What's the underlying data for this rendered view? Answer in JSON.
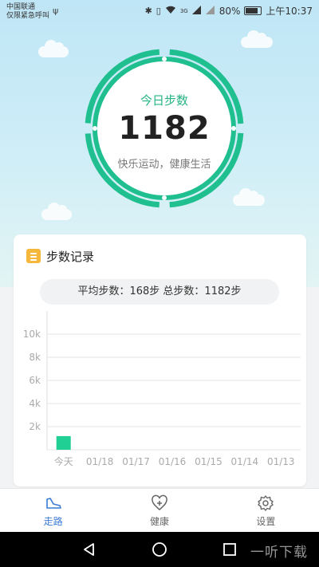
{
  "status_bar": {
    "carrier_line1": "中国联通",
    "carrier_line2": "仅限紧急呼叫",
    "battery": "80%",
    "time": "上午10:37",
    "network": "3G"
  },
  "today": {
    "label": "今日步数",
    "steps": "1182",
    "slogan": "快乐运动，健康生活"
  },
  "record": {
    "title": "步数记录",
    "summary": "平均步数：168步  总步数：1182步"
  },
  "chart_data": {
    "type": "bar",
    "categories": [
      "今天",
      "01/18",
      "01/17",
      "01/16",
      "01/15",
      "01/14",
      "01/13"
    ],
    "values": [
      1182,
      0,
      0,
      0,
      0,
      0,
      0
    ],
    "y_ticks": [
      "2k",
      "4k",
      "6k",
      "8k",
      "10k"
    ],
    "ylim": [
      0,
      12000
    ],
    "grid": true,
    "bar_color": "#1fcf93"
  },
  "nav": {
    "items": [
      {
        "label": "走路",
        "icon": "shoe-icon",
        "active": true
      },
      {
        "label": "健康",
        "icon": "heart-plus-icon",
        "active": false
      },
      {
        "label": "设置",
        "icon": "gear-icon",
        "active": false
      }
    ]
  },
  "watermark": "一听下载",
  "colors": {
    "accent": "#1fbf8f",
    "nav_active": "#3a7bd5",
    "card_icon": "#f5b83d"
  }
}
